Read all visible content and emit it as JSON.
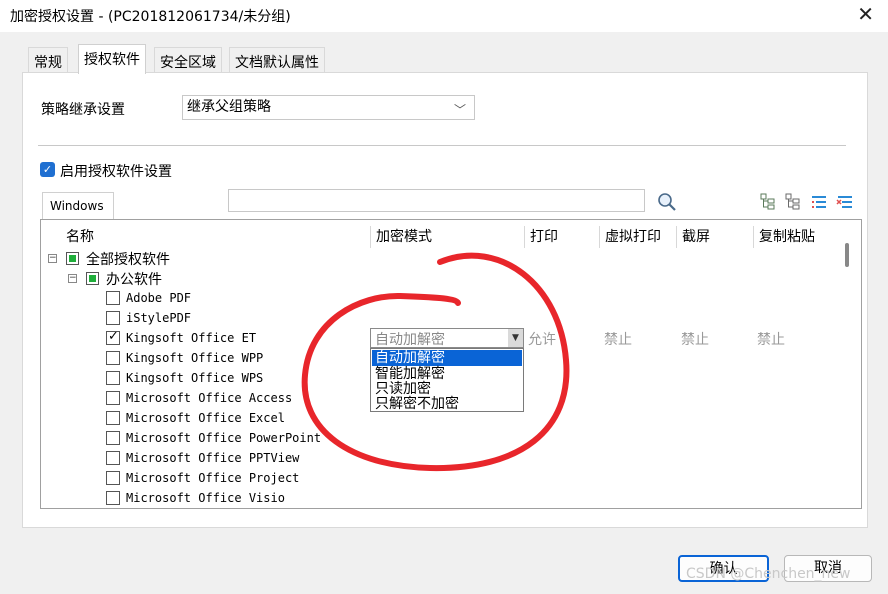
{
  "window": {
    "title": "加密授权设置 - (PC201812061734/未分组)",
    "close": "✕"
  },
  "tabs": [
    "常规",
    "授权软件",
    "安全区域",
    "文档默认属性"
  ],
  "policy": {
    "label": "策略继承设置",
    "value": "继承父组策略"
  },
  "enable": {
    "label": "启用授权软件设置",
    "checked": true
  },
  "platform_tab": "Windows",
  "search": {
    "value": ""
  },
  "columns": [
    "名称",
    "加密模式",
    "打印",
    "虚拟打印",
    "截屏",
    "复制粘贴"
  ],
  "tree": {
    "root": "全部授权软件",
    "group": "办公软件",
    "apps": [
      {
        "name": "Adobe PDF",
        "checked": false
      },
      {
        "name": "iStylePDF",
        "checked": false
      },
      {
        "name": "Kingsoft Office ET",
        "checked": true
      },
      {
        "name": "Kingsoft Office WPP",
        "checked": false
      },
      {
        "name": "Kingsoft Office WPS",
        "checked": false
      },
      {
        "name": "Microsoft Office Access",
        "checked": false
      },
      {
        "name": "Microsoft Office Excel",
        "checked": false
      },
      {
        "name": "Microsoft Office PowerPoint",
        "checked": false
      },
      {
        "name": "Microsoft Office PPTView",
        "checked": false
      },
      {
        "name": "Microsoft Office Project",
        "checked": false
      },
      {
        "name": "Microsoft Office Visio",
        "checked": false
      }
    ]
  },
  "selected_row": {
    "mode": "自动加解密",
    "print": "允许",
    "virtual_print": "禁止",
    "screenshot": "禁止",
    "copy_paste": "禁止"
  },
  "mode_options": [
    "自动加解密",
    "智能加解密",
    "只读加密",
    "只解密不加密"
  ],
  "buttons": {
    "ok": "确认",
    "cancel": "取消"
  },
  "watermark": "CSDN @Chenchen_new",
  "colors": {
    "accent": "#0a64d6",
    "tree_green": "#1fae3a",
    "annotation_red": "#e8262b"
  }
}
